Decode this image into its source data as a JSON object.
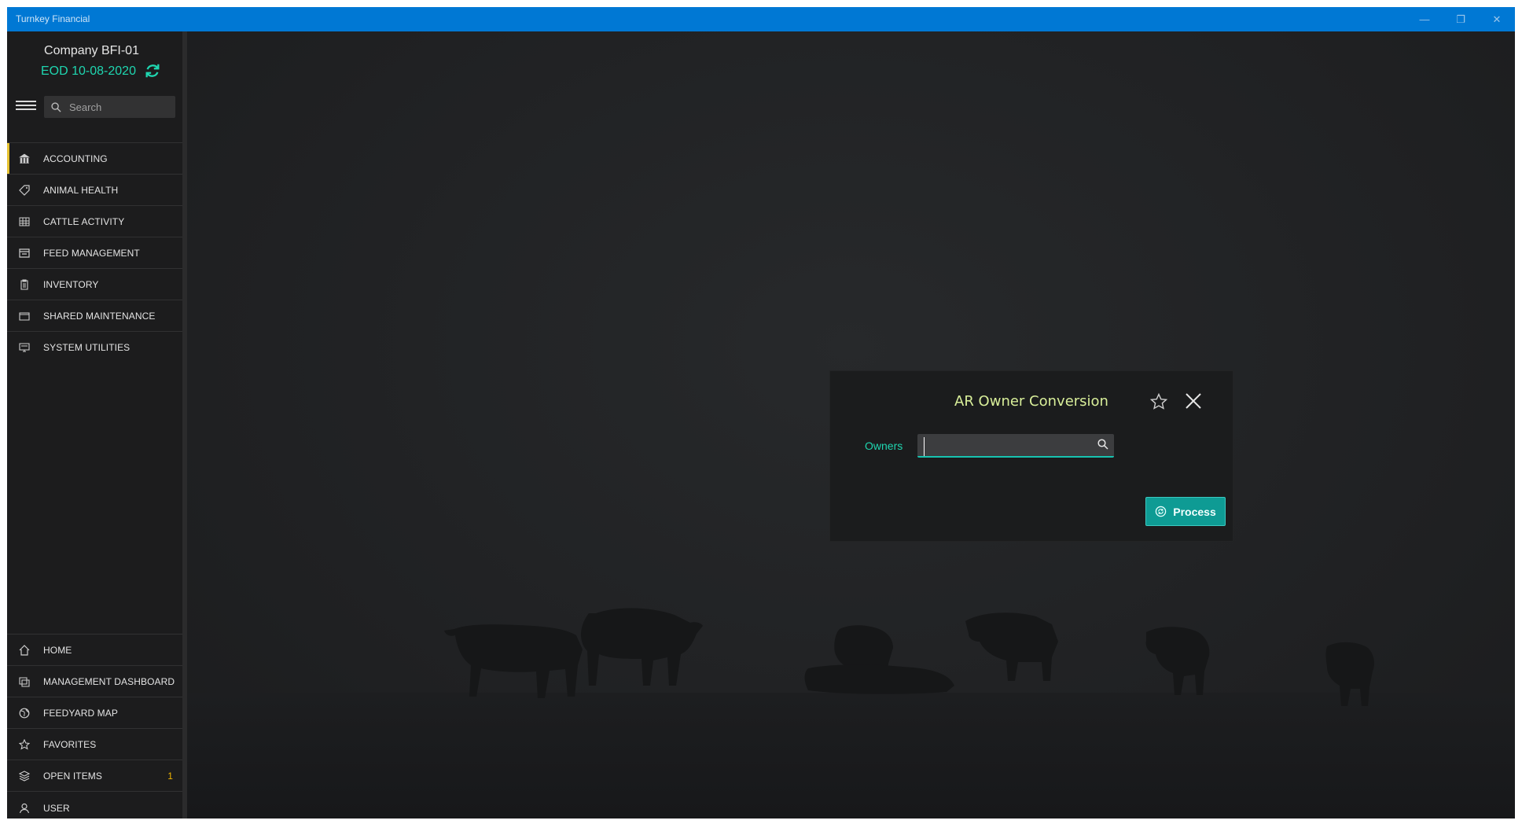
{
  "window": {
    "title": "Turnkey Financial",
    "controls": [
      "minimize-icon",
      "restore-icon",
      "close-icon"
    ],
    "accent_color": "#0078d4"
  },
  "sidebar": {
    "company": "Company BFI-01",
    "eod": "EOD 10-08-2020",
    "search_placeholder": "Search",
    "items": [
      {
        "label": "ACCOUNTING",
        "icon": "bank-icon",
        "active": true
      },
      {
        "label": "ANIMAL HEALTH",
        "icon": "tag-icon"
      },
      {
        "label": "CATTLE ACTIVITY",
        "icon": "grid-icon"
      },
      {
        "label": "FEED MANAGEMENT",
        "icon": "feed-icon"
      },
      {
        "label": "INVENTORY",
        "icon": "clipboard-icon"
      },
      {
        "label": "SHARED MAINTENANCE",
        "icon": "folder-icon"
      },
      {
        "label": "SYSTEM UTILITIES",
        "icon": "monitor-icon"
      }
    ],
    "bottom_items": [
      {
        "label": "HOME",
        "icon": "home-icon"
      },
      {
        "label": "MANAGEMENT DASHBOARD",
        "icon": "dashboard-icon"
      },
      {
        "label": "FEEDYARD MAP",
        "icon": "globe-icon"
      },
      {
        "label": "FAVORITES",
        "icon": "star-icon"
      },
      {
        "label": "OPEN ITEMS",
        "icon": "layers-icon",
        "badge": "1"
      },
      {
        "label": "USER",
        "icon": "user-icon"
      }
    ],
    "active_color": "#e6c230",
    "accent_color": "#1fd6b0"
  },
  "dialog": {
    "title": "AR Owner Conversion",
    "owners_label": "Owners",
    "owners_value": "",
    "process_label": "Process",
    "button_color": "#0e9b94"
  }
}
